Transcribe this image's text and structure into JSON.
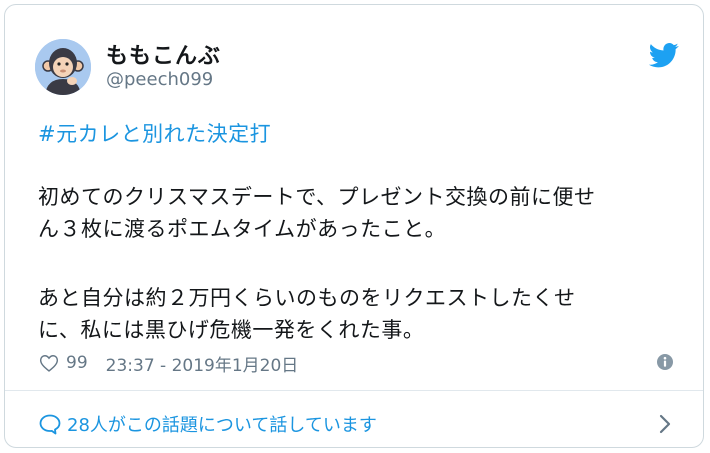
{
  "tweet": {
    "display_name": "ももこんぶ",
    "handle": "@peech099",
    "hashtag": "#元カレと別れた決定打",
    "paragraph1_lines": [
      "初めてのクリスマスデートで、プレゼント交換の前に便せ",
      "ん３枚に渡るポエムタイムがあったこと。"
    ],
    "paragraph2_lines": [
      "あと自分は約２万円くらいのものをリクエストしたくせ",
      "に、私には黒ひげ危機一発をくれた事。"
    ],
    "like_count": "99",
    "timestamp": "23:37 - 2019年1月20日",
    "conversation_link": "28人がこの話題について話しています"
  },
  "icons": {
    "brand": "twitter-bird-icon",
    "like": "heart-icon",
    "info": "info-icon",
    "conversation": "speech-bubble-icon",
    "chevron": "chevron-right-icon"
  },
  "colors": {
    "accent": "#1b95e0",
    "text": "#14171a",
    "muted": "#657786",
    "border": "#cfd9de"
  }
}
